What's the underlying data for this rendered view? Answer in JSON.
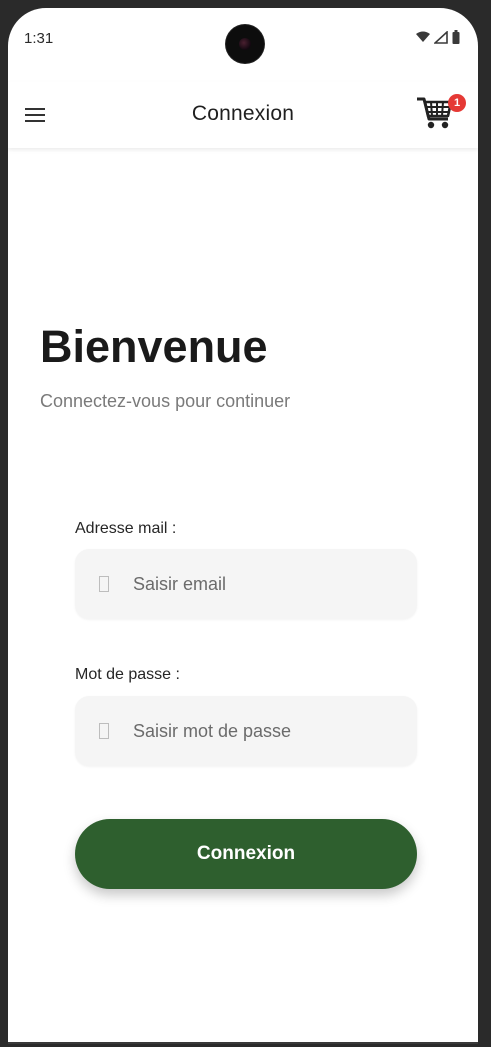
{
  "status_bar": {
    "time": "1:31",
    "icons": [
      "wifi-icon",
      "signal-icon",
      "battery-icon"
    ]
  },
  "app_bar": {
    "title": "Connexion",
    "menu_icon": "hamburger-menu-icon",
    "cart_icon": "shopping-cart-icon",
    "cart_badge": "1"
  },
  "welcome": {
    "title": "Bienvenue",
    "subtitle": "Connectez-vous pour continuer"
  },
  "form": {
    "email": {
      "label": "Adresse mail :",
      "placeholder": "Saisir email",
      "value": ""
    },
    "password": {
      "label": "Mot de passe :",
      "placeholder": "Saisir mot de passe",
      "value": ""
    },
    "submit_label": "Connexion"
  },
  "colors": {
    "primary": "#2e5f2e",
    "badge": "#e53935",
    "field_background": "#f5f5f5",
    "subtitle": "#7a7a7a"
  }
}
